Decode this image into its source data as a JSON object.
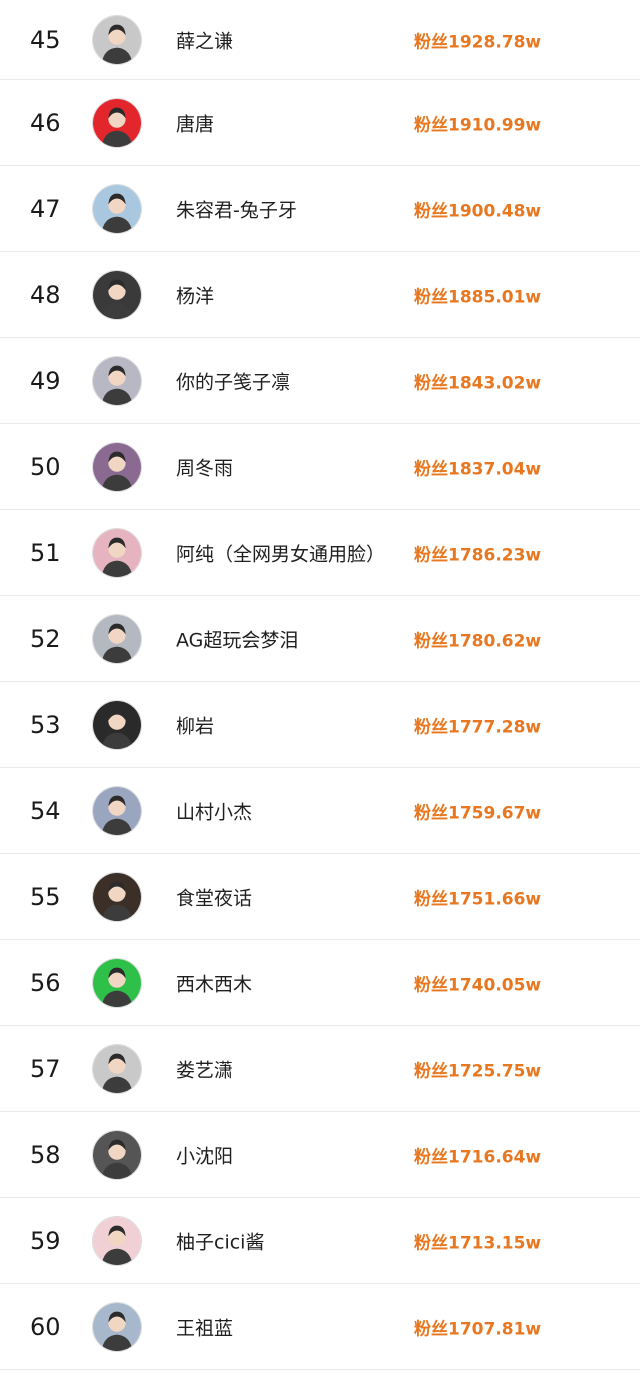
{
  "ranking": {
    "rows": [
      {
        "rank": "45",
        "name": "薛之谦",
        "fans": "粉丝1928.78w",
        "avatar_icon": "portrait-man-dark-hair-icon",
        "avatar_bg": "#c8c8c8"
      },
      {
        "rank": "46",
        "name": "唐唐",
        "fans": "粉丝1910.99w",
        "avatar_icon": "cartoon-pig-red-icon",
        "avatar_bg": "#e3262b"
      },
      {
        "rank": "47",
        "name": "朱容君-兔子牙",
        "fans": "粉丝1900.48w",
        "avatar_icon": "portrait-woman-light-icon",
        "avatar_bg": "#a9c7de"
      },
      {
        "rank": "48",
        "name": "杨洋",
        "fans": "粉丝1885.01w",
        "avatar_icon": "portrait-man-dark-icon",
        "avatar_bg": "#3a3a3a"
      },
      {
        "rank": "49",
        "name": "你的子笺子凛",
        "fans": "粉丝1843.02w",
        "avatar_icon": "portrait-couple-icon",
        "avatar_bg": "#b8b8c4"
      },
      {
        "rank": "50",
        "name": "周冬雨",
        "fans": "粉丝1837.04w",
        "avatar_icon": "portrait-woman-short-hair-icon",
        "avatar_bg": "#8a6a90"
      },
      {
        "rank": "51",
        "name": "阿纯（全网男女通用脸）",
        "fans": "粉丝1786.23w",
        "avatar_icon": "portrait-woman-pink-hair-icon",
        "avatar_bg": "#e6b4c0"
      },
      {
        "rank": "52",
        "name": "AG超玩会梦泪",
        "fans": "粉丝1780.62w",
        "avatar_icon": "portrait-young-man-icon",
        "avatar_bg": "#b4b8c0"
      },
      {
        "rank": "53",
        "name": "柳岩",
        "fans": "粉丝1777.28w",
        "avatar_icon": "portrait-woman-dark-hair-icon",
        "avatar_bg": "#2a2a2a"
      },
      {
        "rank": "54",
        "name": "山村小杰",
        "fans": "粉丝1759.67w",
        "avatar_icon": "portrait-group-icon",
        "avatar_bg": "#9aa6c0"
      },
      {
        "rank": "55",
        "name": "食堂夜话",
        "fans": "粉丝1751.66w",
        "avatar_icon": "portrait-man-dim-icon",
        "avatar_bg": "#3b2f27"
      },
      {
        "rank": "56",
        "name": "西木西木",
        "fans": "粉丝1740.05w",
        "avatar_icon": "portrait-man-green-bg-icon",
        "avatar_bg": "#2fc04a"
      },
      {
        "rank": "57",
        "name": "娄艺潇",
        "fans": "粉丝1725.75w",
        "avatar_icon": "portrait-woman-grey-icon",
        "avatar_bg": "#c9c9c9"
      },
      {
        "rank": "58",
        "name": "小沈阳",
        "fans": "粉丝1716.64w",
        "avatar_icon": "portrait-man-suit-icon",
        "avatar_bg": "#555555"
      },
      {
        "rank": "59",
        "name": "柚子cici酱",
        "fans": "粉丝1713.15w",
        "avatar_icon": "portrait-woman-red-lips-icon",
        "avatar_bg": "#f0d0d4"
      },
      {
        "rank": "60",
        "name": "王祖蓝",
        "fans": "粉丝1707.81w",
        "avatar_icon": "portrait-couple-light-icon",
        "avatar_bg": "#a8b8cc"
      }
    ]
  }
}
